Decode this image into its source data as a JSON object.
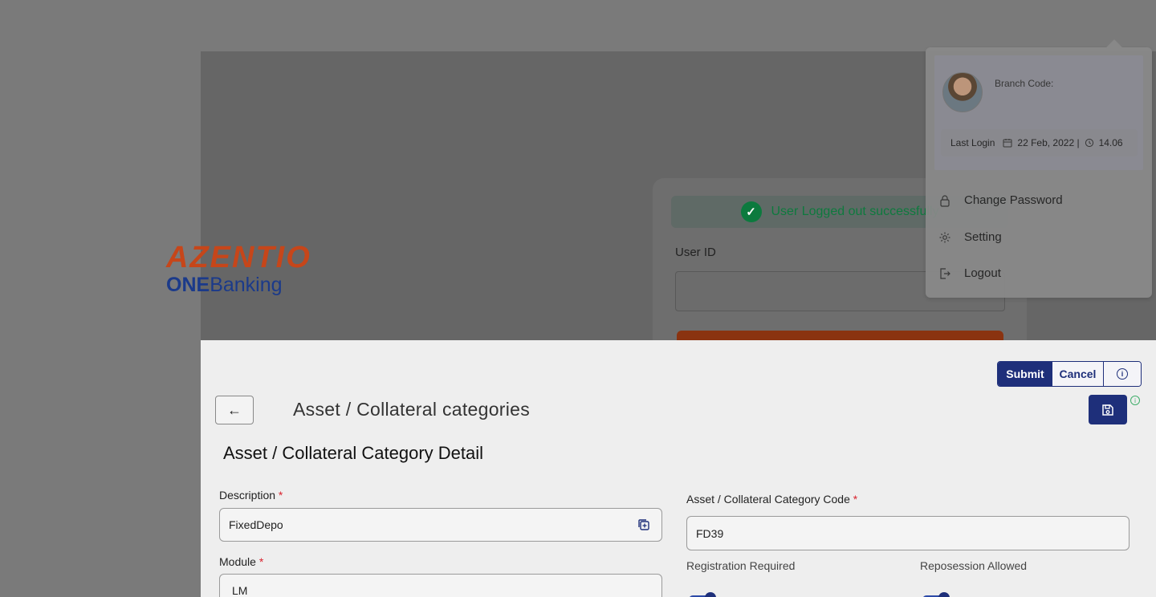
{
  "login": {
    "brand_top": "AZENTIO",
    "brand_one": "ONE",
    "brand_banking": "Banking",
    "toast_message": "User Logged out successfully",
    "userid_label": "User ID",
    "userid_value": ""
  },
  "profile": {
    "branch_code_label": "Branch Code:",
    "last_login_label": "Last Login",
    "last_login_date": "22 Feb, 2022 |",
    "last_login_time": "14.06",
    "menu": [
      {
        "label": "Change Password",
        "icon": "lock-icon"
      },
      {
        "label": "Setting",
        "icon": "gear-icon"
      },
      {
        "label": "Logout",
        "icon": "logout-icon"
      }
    ]
  },
  "toolbar": {
    "submit_label": "Submit",
    "cancel_label": "Cancel"
  },
  "page": {
    "title": "Asset / Collateral categories",
    "section_title": "Asset / Collateral Category Detail"
  },
  "form": {
    "description_label": "Description",
    "description_value": "FixedDepo",
    "module_label": "Module",
    "module_value": "LM",
    "code_label": "Asset / Collateral Category Code",
    "code_value": "FD39",
    "registration_label": "Registration Required",
    "repossession_label": "Reposession Allowed",
    "required_mark": "*"
  },
  "colors": {
    "primary": "#1e2f7a",
    "brand_orange": "#c6461a",
    "success": "#0c7a3e",
    "required": "#d9232e"
  }
}
